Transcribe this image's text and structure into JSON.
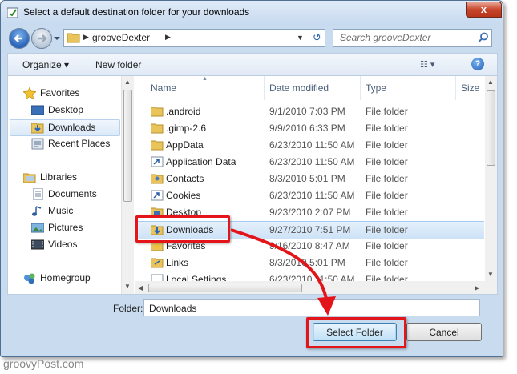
{
  "window": {
    "title": "Select a default destination folder for your downloads",
    "close_glyph": "x"
  },
  "address": {
    "path": "grooveDexter",
    "search_placeholder": "Search grooveDexter",
    "refresh_glyph": "↺"
  },
  "toolbar": {
    "organize": "Organize ▾",
    "new_folder": "New folder",
    "views_glyph": "☷ ▾",
    "help_glyph": "?"
  },
  "nav": {
    "items": [
      {
        "label": "Favorites",
        "icon": "star-icon"
      },
      {
        "label": "Desktop",
        "icon": "desktop-icon"
      },
      {
        "label": "Downloads",
        "icon": "downloads-folder-icon"
      },
      {
        "label": "Recent Places",
        "icon": "recent-places-icon"
      },
      {
        "label": "Libraries",
        "icon": "libraries-icon"
      },
      {
        "label": "Documents",
        "icon": "documents-icon"
      },
      {
        "label": "Music",
        "icon": "music-icon"
      },
      {
        "label": "Pictures",
        "icon": "pictures-icon"
      },
      {
        "label": "Videos",
        "icon": "videos-icon"
      },
      {
        "label": "Homegroup",
        "icon": "homegroup-icon"
      }
    ]
  },
  "columns": {
    "name": "Name",
    "date": "Date modified",
    "type": "Type",
    "size": "Size"
  },
  "files": [
    {
      "name": ".android",
      "date": "9/1/2010 7:03 PM",
      "type": "File folder"
    },
    {
      "name": ".gimp-2.6",
      "date": "9/9/2010 6:33 PM",
      "type": "File folder"
    },
    {
      "name": "AppData",
      "date": "6/23/2010 11:50 AM",
      "type": "File folder"
    },
    {
      "name": "Application Data",
      "date": "6/23/2010 11:50 AM",
      "type": "File folder"
    },
    {
      "name": "Contacts",
      "date": "8/3/2010 5:01 PM",
      "type": "File folder"
    },
    {
      "name": "Cookies",
      "date": "6/23/2010 11:50 AM",
      "type": "File folder"
    },
    {
      "name": "Desktop",
      "date": "9/23/2010 2:07 PM",
      "type": "File folder"
    },
    {
      "name": "Downloads",
      "date": "9/27/2010 7:51 PM",
      "type": "File folder"
    },
    {
      "name": "Favorites",
      "date": "9/16/2010 8:47 AM",
      "type": "File folder"
    },
    {
      "name": "Links",
      "date": "8/3/2010 5:01 PM",
      "type": "File folder"
    },
    {
      "name": "Local Settings",
      "date": "6/23/2010 11:50 AM",
      "type": "File folder"
    }
  ],
  "footer": {
    "folder_label": "Folder:",
    "folder_value": "Downloads",
    "select_button": "Select Folder",
    "cancel_button": "Cancel"
  },
  "watermark": "groovyPost.com",
  "colors": {
    "highlight": "#e3141a",
    "selection": "#cde2f7",
    "window_frame": "#c9dcef"
  }
}
